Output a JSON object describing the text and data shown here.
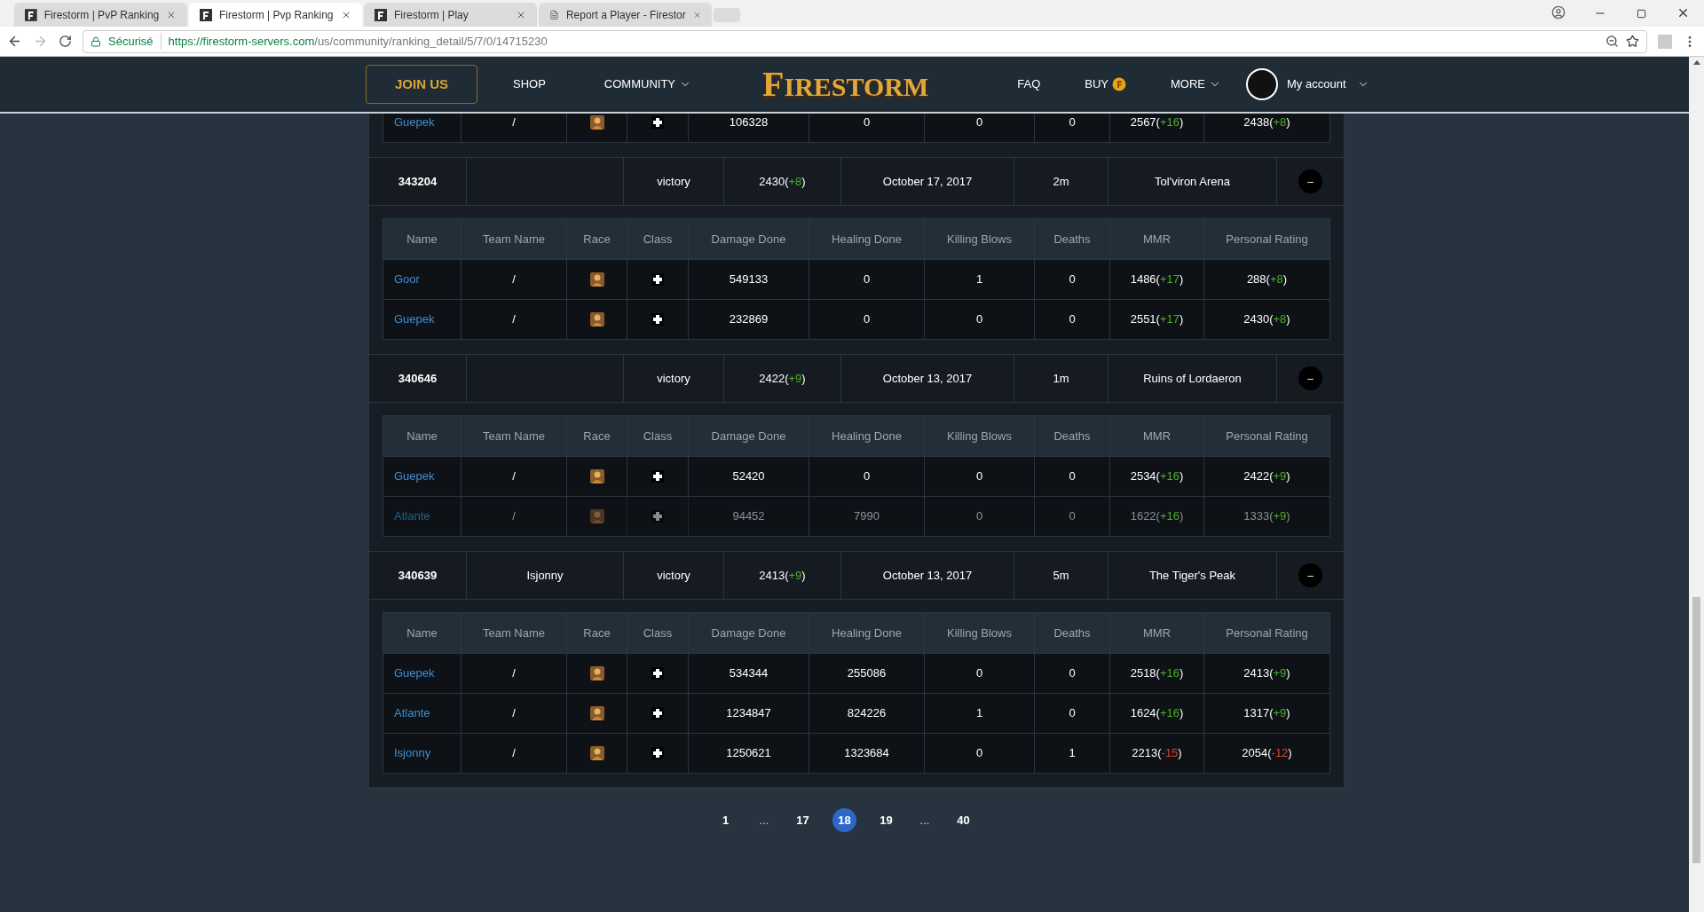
{
  "browser": {
    "tabs": [
      {
        "title": "Firestorm | PvP Ranking",
        "selected": false,
        "kind": "site"
      },
      {
        "title": "Firestorm | Pvp Ranking",
        "selected": true,
        "kind": "site"
      },
      {
        "title": "Firestorm | Play",
        "selected": false,
        "kind": "site"
      },
      {
        "title": "Report a Player - Firestor",
        "selected": false,
        "kind": "page"
      }
    ],
    "security": "Sécurisé",
    "url_host": "https://firestorm-servers.com",
    "url_path": "/us/community/ranking_detail/5/7/0/14715230"
  },
  "nav": {
    "join": "JOIN US",
    "left": [
      {
        "label": "SHOP",
        "kind": "link"
      },
      {
        "label": "COMMUNITY",
        "kind": "dropdown"
      }
    ],
    "logo": "FIRESTORM",
    "right": [
      {
        "label": "FAQ",
        "kind": "link"
      },
      {
        "label": "BUY",
        "kind": "coin"
      },
      {
        "label": "MORE",
        "kind": "dropdown"
      }
    ],
    "account": "My account"
  },
  "partial_rows": [
    {
      "name": "Guepek",
      "team": "/",
      "dimmed": false,
      "damage": "106328",
      "healing": "0",
      "kills": "0",
      "deaths": "0",
      "mmr": {
        "value": "2567(",
        "delta": "+16",
        "color": "#4caf2a",
        "close": ")"
      },
      "rating": {
        "value": "2438(",
        "delta": "+8",
        "color": "#4caf2a",
        "close": ")"
      }
    }
  ],
  "matches": [
    {
      "id": "343204",
      "result": "victory",
      "rating": {
        "value": "2430(",
        "delta": "+8",
        "color": "#4caf2a",
        "close": ")"
      },
      "date": "October 17, 2017",
      "duration": "2m",
      "map": "Tol'viron Arena",
      "toggle": "–",
      "columns": [
        "Name",
        "Team Name",
        "Race",
        "Class",
        "Damage Done",
        "Healing Done",
        "Killing Blows",
        "Deaths",
        "MMR",
        "Personal Rating"
      ],
      "players": [
        {
          "name": "Goor",
          "team": "/",
          "dimmed": false,
          "damage": "549133",
          "healing": "0",
          "kills": "1",
          "deaths": "0",
          "mmr": {
            "value": "1486(",
            "delta": "+17",
            "color": "#4caf2a",
            "close": ")"
          },
          "rating": {
            "value": "288(",
            "delta": "+8",
            "color": "#4caf2a",
            "close": ")"
          }
        },
        {
          "name": "Guepek",
          "team": "/",
          "dimmed": false,
          "damage": "232869",
          "healing": "0",
          "kills": "0",
          "deaths": "0",
          "mmr": {
            "value": "2551(",
            "delta": "+17",
            "color": "#4caf2a",
            "close": ")"
          },
          "rating": {
            "value": "2430(",
            "delta": "+8",
            "color": "#4caf2a",
            "close": ")"
          }
        }
      ]
    },
    {
      "id": "340646",
      "result": "victory",
      "rating": {
        "value": "2422(",
        "delta": "+9",
        "color": "#4caf2a",
        "close": ")"
      },
      "date": "October 13, 2017",
      "duration": "1m",
      "map": "Ruins of Lordaeron",
      "toggle": "–",
      "columns": [
        "Name",
        "Team Name",
        "Race",
        "Class",
        "Damage Done",
        "Healing Done",
        "Killing Blows",
        "Deaths",
        "MMR",
        "Personal Rating"
      ],
      "players": [
        {
          "name": "Guepek",
          "team": "/",
          "dimmed": false,
          "damage": "52420",
          "healing": "0",
          "kills": "0",
          "deaths": "0",
          "mmr": {
            "value": "2534(",
            "delta": "+16",
            "color": "#4caf2a",
            "close": ")"
          },
          "rating": {
            "value": "2422(",
            "delta": "+9",
            "color": "#4caf2a",
            "close": ")"
          }
        },
        {
          "name": "Atlante",
          "team": "/",
          "dimmed": true,
          "damage": "94452",
          "healing": "7990",
          "kills": "0",
          "deaths": "0",
          "mmr": {
            "value": "1622(",
            "delta": "+16",
            "color": "#4caf2a",
            "close": ")"
          },
          "rating": {
            "value": "1333(",
            "delta": "+9",
            "color": "#4caf2a",
            "close": ")"
          }
        }
      ]
    },
    {
      "id": "340639",
      "team": "Isjonny",
      "result": "victory",
      "rating": {
        "value": "2413(",
        "delta": "+9",
        "color": "#4caf2a",
        "close": ")"
      },
      "date": "October 13, 2017",
      "duration": "5m",
      "map": "The Tiger's Peak",
      "toggle": "–",
      "columns": [
        "Name",
        "Team Name",
        "Race",
        "Class",
        "Damage Done",
        "Healing Done",
        "Killing Blows",
        "Deaths",
        "MMR",
        "Personal Rating"
      ],
      "players": [
        {
          "name": "Guepek",
          "team": "/",
          "dimmed": false,
          "damage": "534344",
          "healing": "255086",
          "kills": "0",
          "deaths": "0",
          "mmr": {
            "value": "2518(",
            "delta": "+16",
            "color": "#4caf2a",
            "close": ")"
          },
          "rating": {
            "value": "2413(",
            "delta": "+9",
            "color": "#4caf2a",
            "close": ")"
          }
        },
        {
          "name": "Atlante",
          "team": "/",
          "dimmed": false,
          "damage": "1234847",
          "healing": "824226",
          "kills": "1",
          "deaths": "0",
          "mmr": {
            "value": "1624(",
            "delta": "+16",
            "color": "#4caf2a",
            "close": ")"
          },
          "rating": {
            "value": "1317(",
            "delta": "+9",
            "color": "#4caf2a",
            "close": ")"
          }
        },
        {
          "name": "Isjonny",
          "team": "/",
          "dimmed": false,
          "damage": "1250621",
          "healing": "1323684",
          "kills": "0",
          "deaths": "1",
          "mmr": {
            "value": "2213(",
            "delta": "-15",
            "color": "#e0412f",
            "close": ")"
          },
          "rating": {
            "value": "2054(",
            "delta": "-12",
            "color": "#e0412f",
            "close": ")"
          }
        }
      ]
    }
  ],
  "pagination": [
    {
      "label": "1",
      "kind": "page",
      "selected": false
    },
    {
      "label": "...",
      "kind": "gap",
      "selected": false
    },
    {
      "label": "17",
      "kind": "page",
      "selected": false
    },
    {
      "label": "18",
      "kind": "page",
      "selected": true
    },
    {
      "label": "19",
      "kind": "page",
      "selected": false
    },
    {
      "label": "...",
      "kind": "gap",
      "selected": false
    },
    {
      "label": "40",
      "kind": "page",
      "selected": false
    }
  ]
}
